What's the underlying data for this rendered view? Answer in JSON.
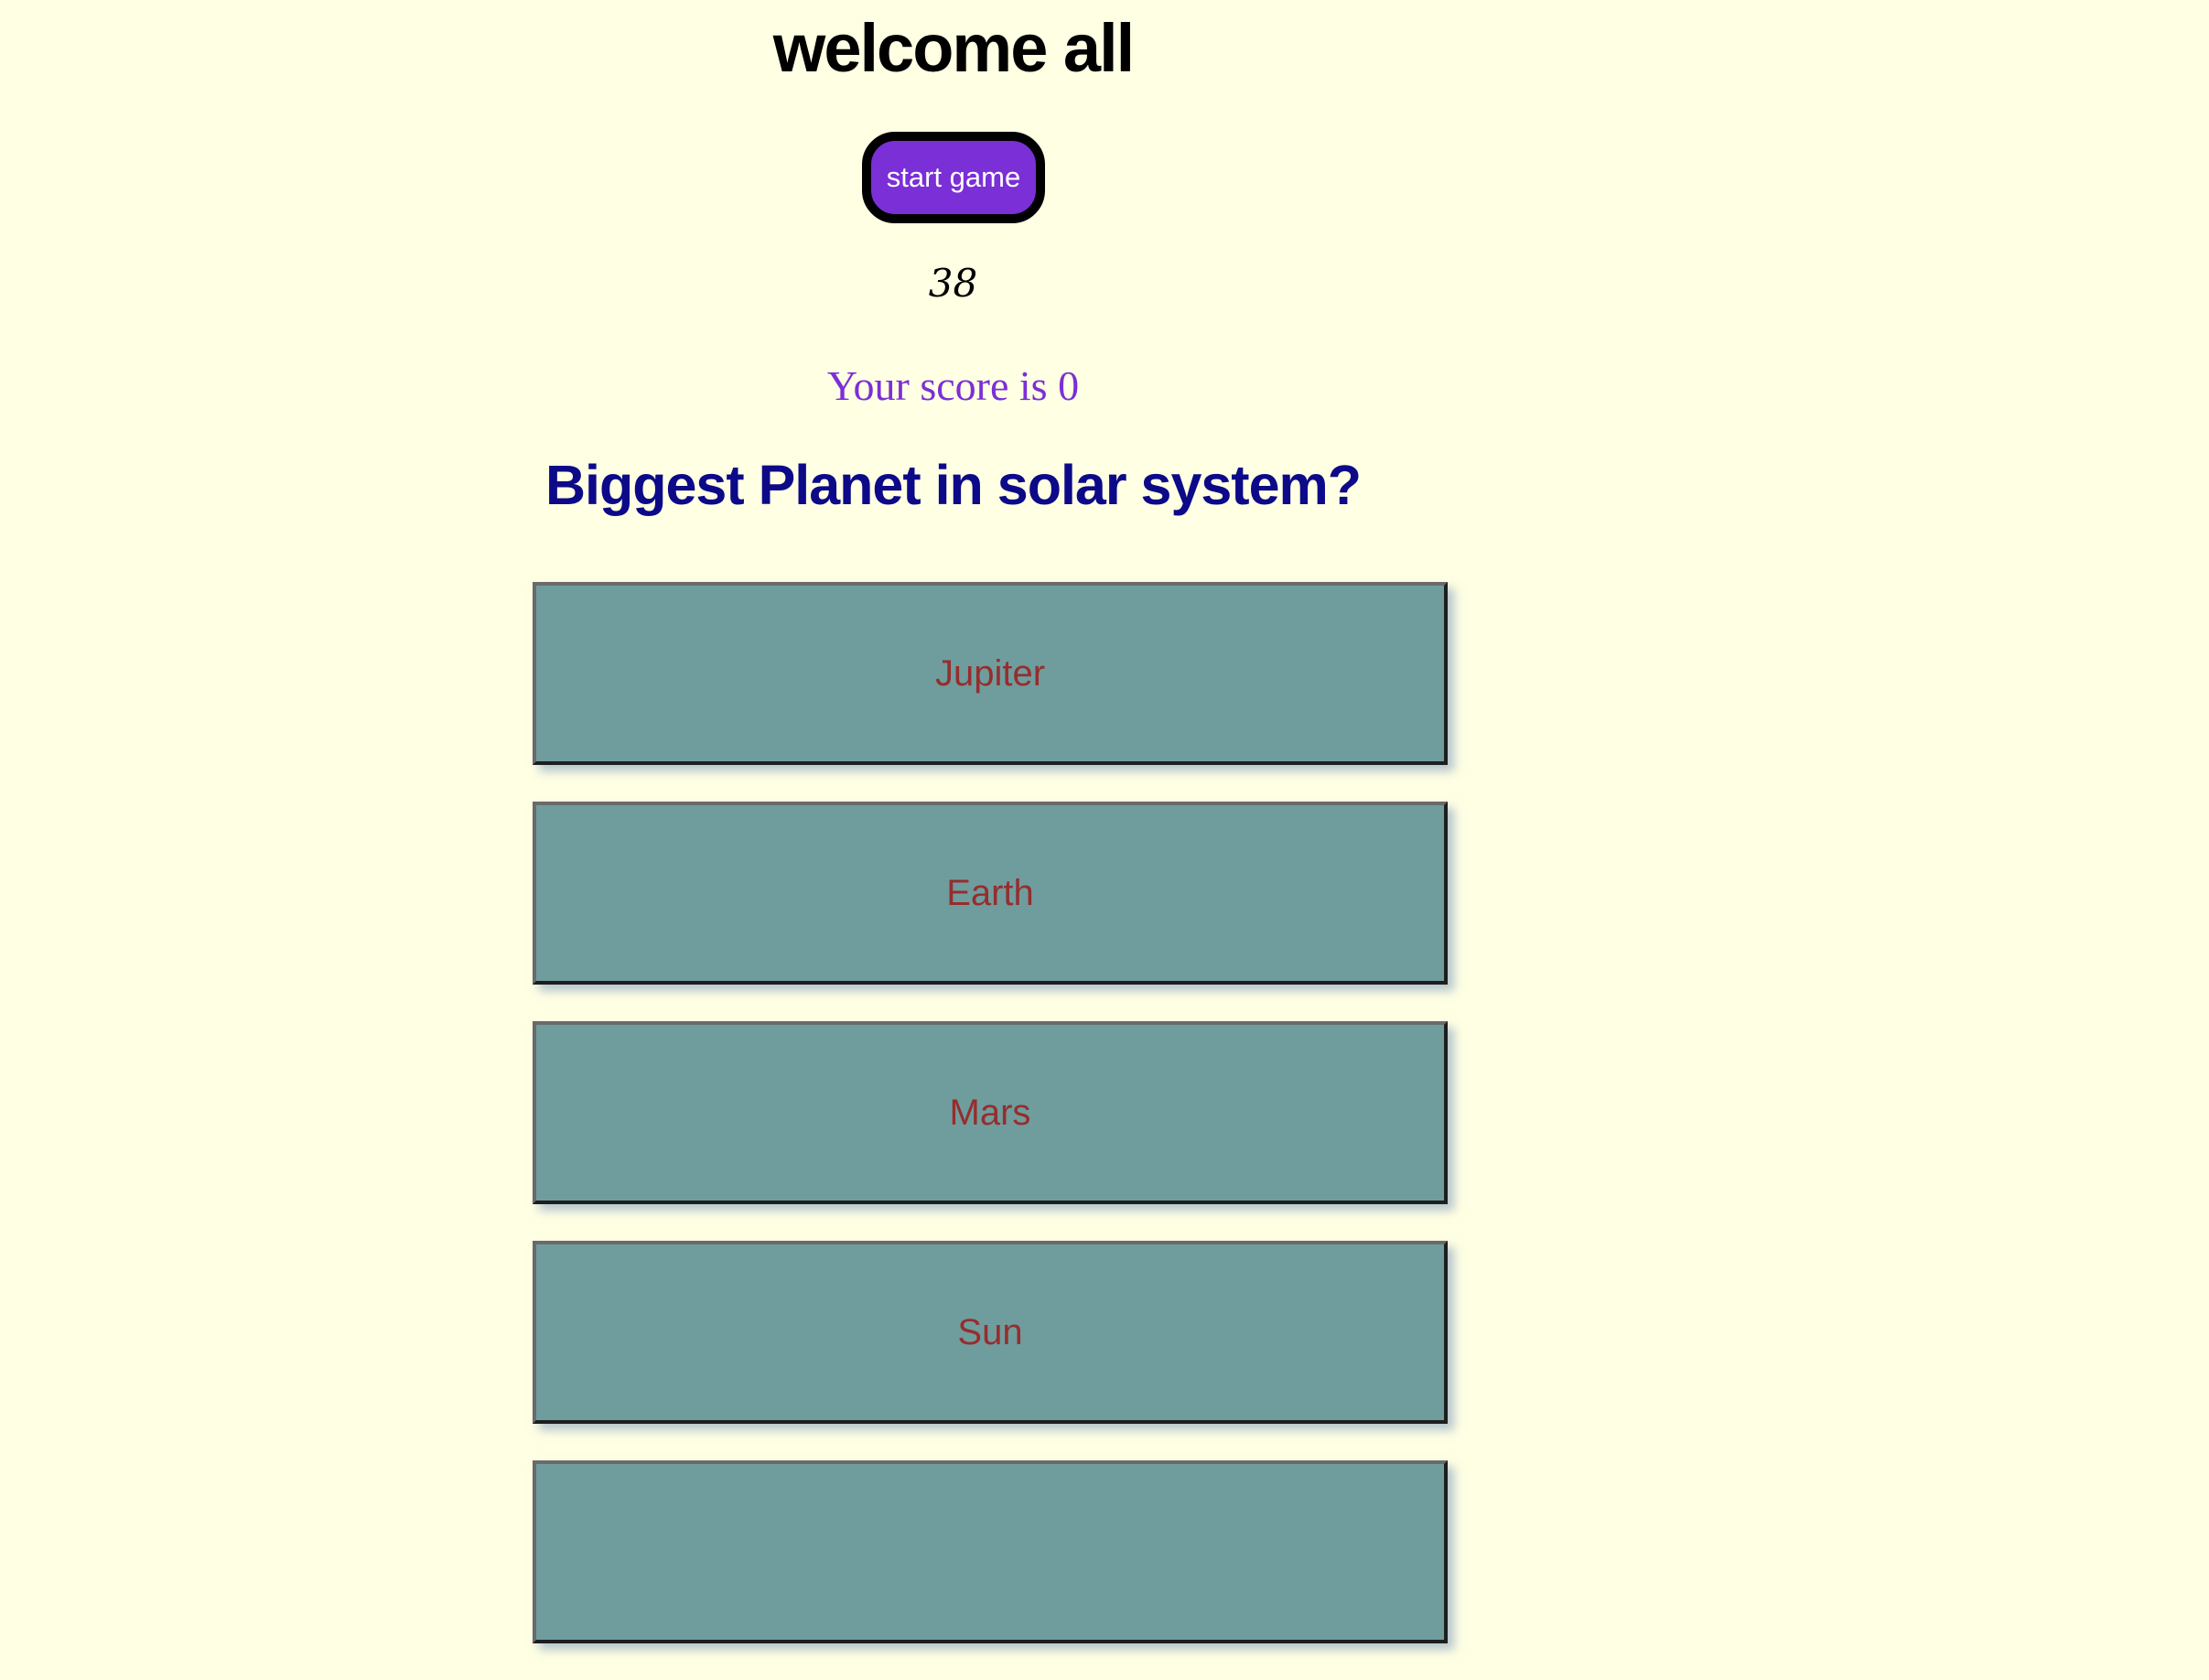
{
  "header": {
    "title": "welcome all"
  },
  "controls": {
    "start_label": "start game"
  },
  "timer": {
    "value": "38"
  },
  "score": {
    "text": "Your score is 0"
  },
  "quiz": {
    "question": "Biggest Planet in solar system?",
    "options": [
      {
        "label": "Jupiter"
      },
      {
        "label": "Earth"
      },
      {
        "label": "Mars"
      },
      {
        "label": "Sun"
      },
      {
        "label": ""
      }
    ]
  },
  "colors": {
    "background": "#ffffe3",
    "accent": "#7b2fd6",
    "question": "#0c0a88",
    "option_bg": "#6f9d9e",
    "option_text": "#962d2d"
  }
}
